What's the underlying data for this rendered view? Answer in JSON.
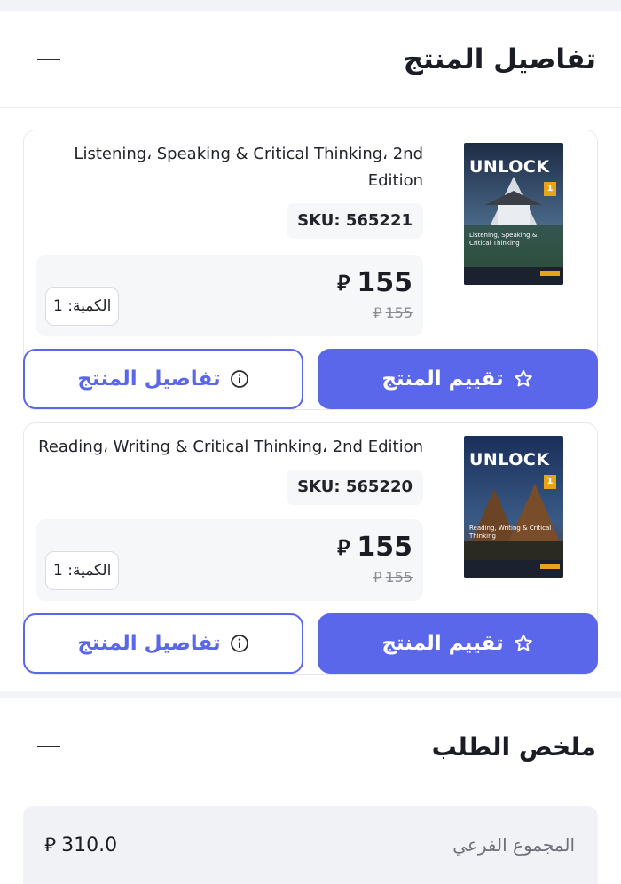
{
  "details": {
    "title": "تفاصيل المنتج"
  },
  "currency_symbol": "⃁",
  "products": [
    {
      "title": "Listening، Speaking & Critical Thinking، 2nd Edition",
      "sku": "SKU: 565221",
      "price": "155",
      "old_price": "155",
      "quantity": "الكمية: 1",
      "rate_label": "تقييم المنتج",
      "details_label": "تفاصيل المنتج",
      "cover": {
        "brand": "UNLOCK",
        "level": "1",
        "subtitle": "Listening, Speaking & Critical Thinking",
        "color": "#2a3e5c"
      }
    },
    {
      "title": "Reading، Writing & Critical Thinking، 2nd Edition",
      "sku": "SKU: 565220",
      "price": "155",
      "old_price": "155",
      "quantity": "الكمية: 1",
      "rate_label": "تقييم المنتج",
      "details_label": "تفاصيل المنتج",
      "cover": {
        "brand": "UNLOCK",
        "level": "1",
        "subtitle": "Reading, Writing & Critical Thinking",
        "color": "#213a63"
      }
    }
  ],
  "summary": {
    "title": "ملخص الطلب",
    "subtotal_label": "المجموع الفرعي",
    "subtotal_value": "310.0"
  },
  "colors": {
    "accent": "#5b67ea"
  }
}
